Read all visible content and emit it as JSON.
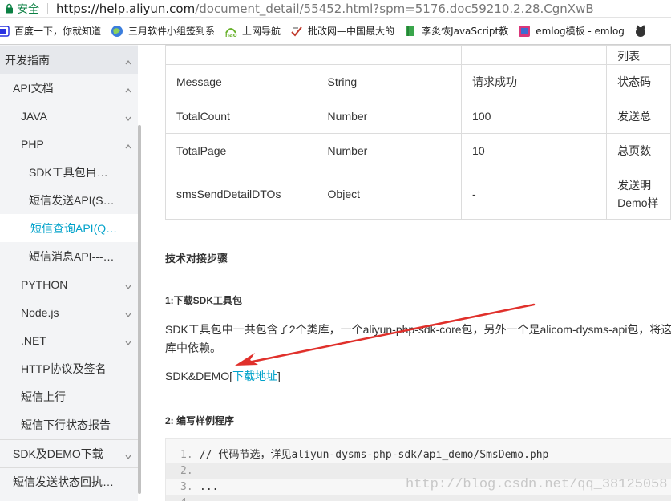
{
  "browser": {
    "secure_label": "安全",
    "url_main": "https://help.aliyun.com",
    "url_rest": "/document_detail/55452.html?spm=5176.doc59210.2.28.CgnXwB"
  },
  "bookmarks": [
    {
      "label": "百度一下，你就知道",
      "icon": "baidu-icon",
      "color": "#2932e1"
    },
    {
      "label": "三月软件小组签到系",
      "icon": "globe-icon",
      "color": "#3b7ddd"
    },
    {
      "label": "上网导航",
      "icon": "hao-icon",
      "color": "#6ab22e"
    },
    {
      "label": "批改网—中国最大的",
      "icon": "check-icon",
      "color": "#c0392b"
    },
    {
      "label": "李炎恢JavaScript教",
      "icon": "book-icon",
      "color": "#3aa64c"
    },
    {
      "label": "emlog模板 - emlog",
      "icon": "emlog-icon",
      "color": "#d9377a"
    },
    {
      "label": "",
      "icon": "github-icon",
      "color": "#333333"
    }
  ],
  "sidebar": {
    "items": [
      {
        "label": "开发指南",
        "chevron": "up"
      },
      {
        "label": "API文档",
        "chevron": "up"
      },
      {
        "label": "JAVA",
        "chevron": "down"
      },
      {
        "label": "PHP",
        "chevron": "up"
      },
      {
        "label": "SDK工具包目…",
        "chevron": ""
      },
      {
        "label": "短信发送API(S…",
        "chevron": ""
      },
      {
        "label": "短信查询API(Q…",
        "chevron": ""
      },
      {
        "label": "短信消息API---…",
        "chevron": ""
      },
      {
        "label": "PYTHON",
        "chevron": "down"
      },
      {
        "label": "Node.js",
        "chevron": "down"
      },
      {
        "label": ".NET",
        "chevron": "down"
      },
      {
        "label": "HTTP协议及签名",
        "chevron": ""
      },
      {
        "label": "短信上行",
        "chevron": ""
      },
      {
        "label": "短信下行状态报告",
        "chevron": ""
      },
      {
        "label": "SDK及DEMO下载",
        "chevron": "down"
      },
      {
        "label": "短信发送状态回执…",
        "chevron": ""
      }
    ],
    "accent_color": "#00a2ca"
  },
  "table": {
    "partial_top": "列表",
    "rows": [
      {
        "name": "Message",
        "type": "String",
        "example": "请求成功",
        "desc": "状态码"
      },
      {
        "name": "TotalCount",
        "type": "Number",
        "example": "100",
        "desc": "发送总"
      },
      {
        "name": "TotalPage",
        "type": "Number",
        "example": "10",
        "desc": "总页数"
      },
      {
        "name": "smsSendDetailDTOs",
        "type": "Object",
        "example": "-",
        "desc": "发送明",
        "desc2": "Demo样"
      }
    ]
  },
  "content": {
    "section_title": "技术对接步骤",
    "step1_title": "1:下载SDK工具包",
    "step1_text": "SDK工具包中一共包含了2个类库，一个aliyun-php-sdk-core包，另外一个是alicom-dysms-api包，将这",
    "step1_text2": "库中依赖。",
    "sdk_prefix": "SDK&DEMO[",
    "sdk_link": "下载地址",
    "sdk_suffix": "]",
    "step2_title": "2: 编写样例程序",
    "code_lines": [
      {
        "no": "1.",
        "text": "// 代码节选，详见aliyun-dysms-php-sdk/api_demo/SmsDemo.php"
      },
      {
        "no": "2.",
        "text": ""
      },
      {
        "no": "3.",
        "text": "..."
      },
      {
        "no": "4.",
        "text": ""
      }
    ]
  },
  "watermark": "http://blog.csdn.net/qq_38125058",
  "annotation_color": "#e0302b"
}
